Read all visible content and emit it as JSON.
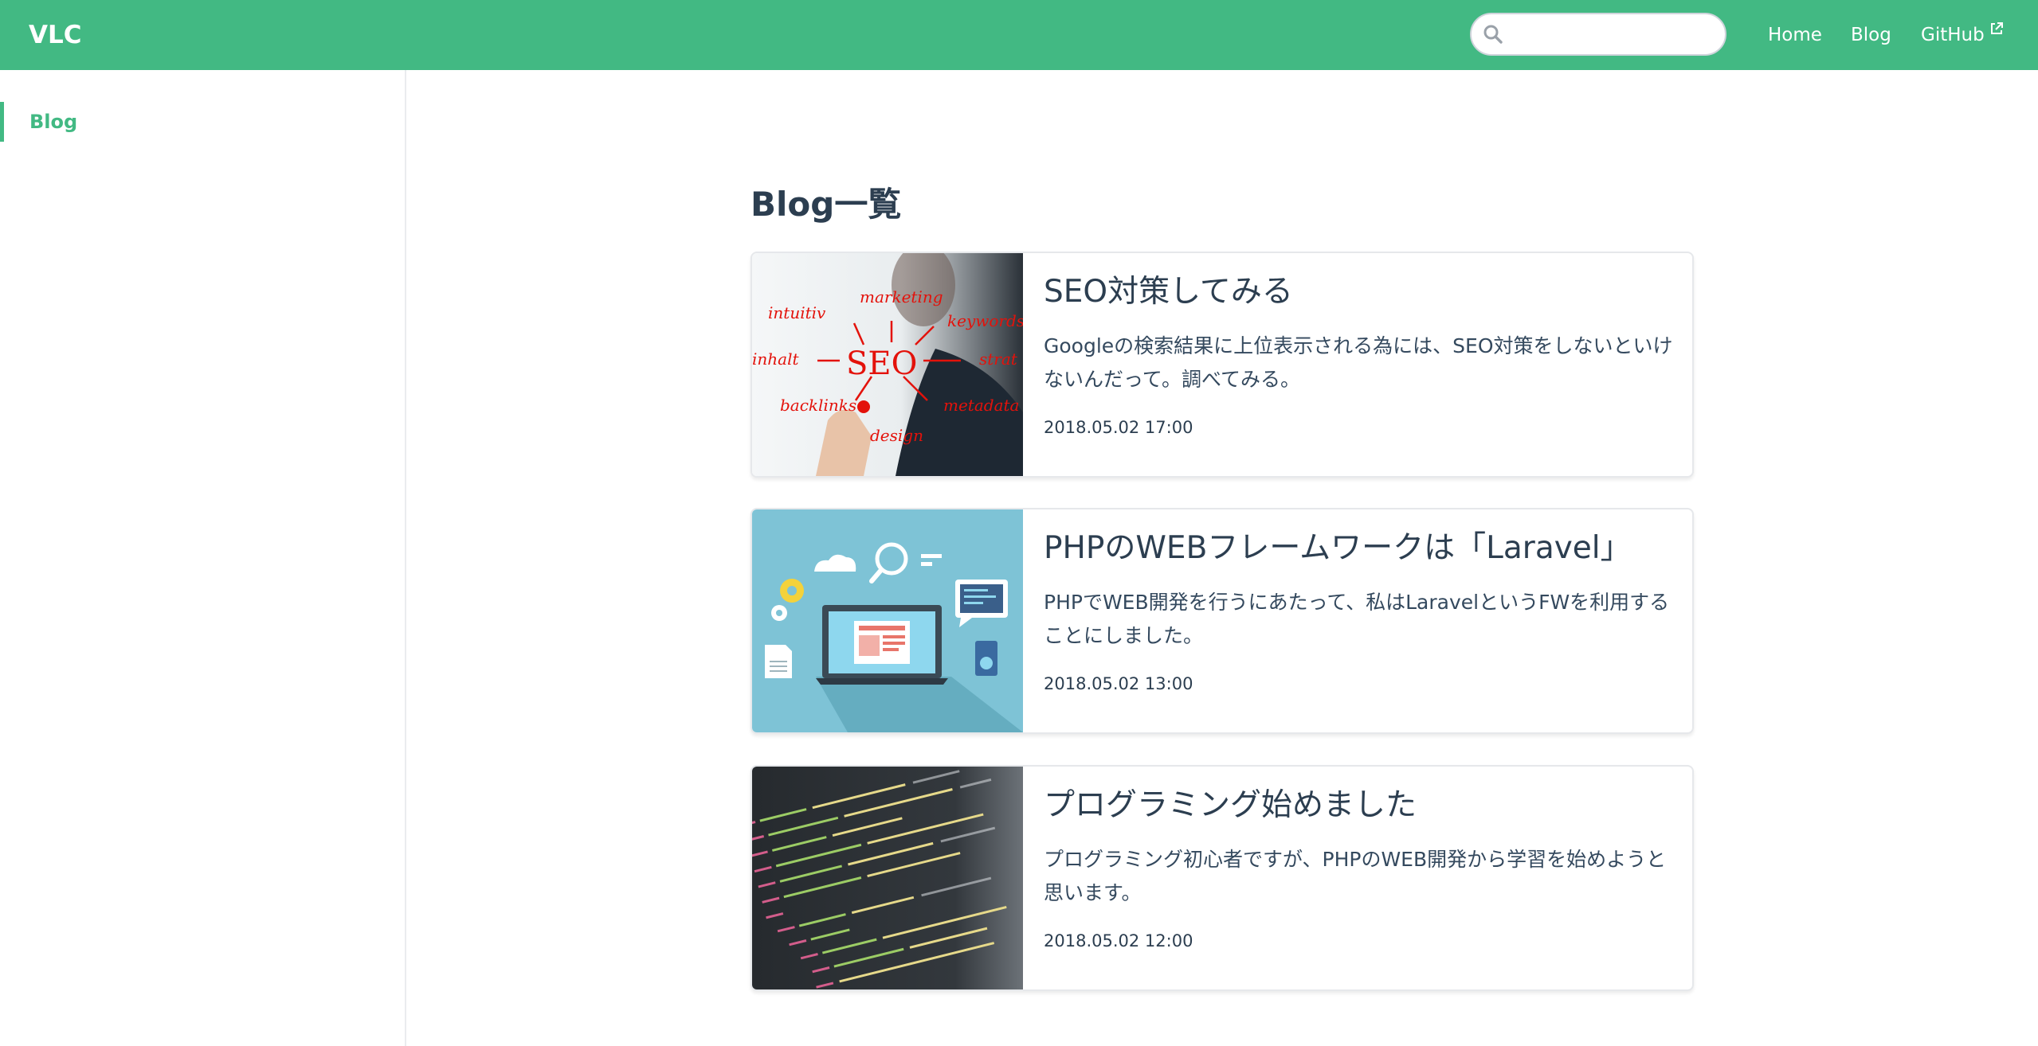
{
  "header": {
    "site_name": "VLC",
    "search": {
      "value": "",
      "placeholder": ""
    },
    "nav": [
      {
        "label": "Home"
      },
      {
        "label": "Blog"
      },
      {
        "label": "GitHub",
        "icon": "external-link-icon"
      }
    ],
    "colors": {
      "brand": "#42b983"
    }
  },
  "sidebar": {
    "items": [
      {
        "label": "Blog",
        "active": true
      }
    ]
  },
  "main": {
    "title": "Blog一覧",
    "posts": [
      {
        "title": "SEO対策してみる",
        "description": "Googleの検索結果に上位表示される為には、SEO対策をしないといけないんだって。調べてみる。",
        "date": "2018.05.02 17:00",
        "thumbnail": "seo-whiteboard-image"
      },
      {
        "title": "PHPのWEBフレームワークは「Laravel」",
        "description": "PHPでWEB開発を行うにあたって、私はLaravelというFWを利用することにしました。",
        "date": "2018.05.02 13:00",
        "thumbnail": "laptop-illustration-image"
      },
      {
        "title": "プログラミング始めました",
        "description": "プログラミング初心者ですが、PHPのWEB開発から学習を始めようと思います。",
        "date": "2018.05.02 12:00",
        "thumbnail": "code-screen-image"
      }
    ]
  }
}
